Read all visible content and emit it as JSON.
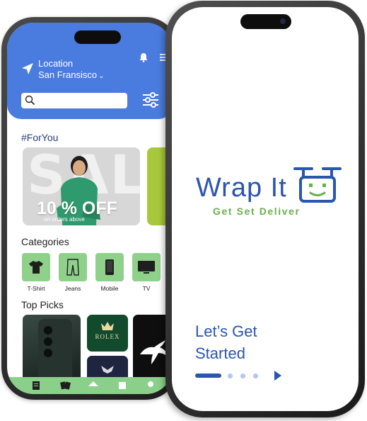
{
  "back_phone": {
    "location": {
      "label": "Location",
      "city": "San Fransisco"
    },
    "search": {
      "value": ""
    },
    "sections": {
      "for_you": "#ForYou",
      "categories": "Categories",
      "top_picks": "Top Picks"
    },
    "banner": {
      "big_text": "SALE",
      "offer": "10 % OFF",
      "sub": "on orders above"
    },
    "categories": [
      {
        "label": "T-Shirt",
        "icon": "tshirt-icon"
      },
      {
        "label": "Jeans",
        "icon": "jeans-icon"
      },
      {
        "label": "Mobile",
        "icon": "mobile-icon"
      },
      {
        "label": "TV",
        "icon": "tv-icon"
      }
    ],
    "top_picks": [
      {
        "icon": "smartphone-product"
      },
      {
        "brand": "ROLEX"
      },
      {
        "icon": "armani-logo"
      },
      {
        "icon": "puma-logo"
      }
    ],
    "colors": {
      "header": "#4a7bde",
      "category_tile": "#8fd18a",
      "nav": "#8bd08a"
    }
  },
  "front_phone": {
    "brand": "Wrap It",
    "tagline": "Get Set Deliver",
    "cta": {
      "line1": "Let’s Get",
      "line2": "Started"
    },
    "pager": {
      "pages": 4,
      "active": 1
    },
    "colors": {
      "brand_blue": "#2a55b0",
      "tagline_green": "#6ab04c"
    }
  }
}
